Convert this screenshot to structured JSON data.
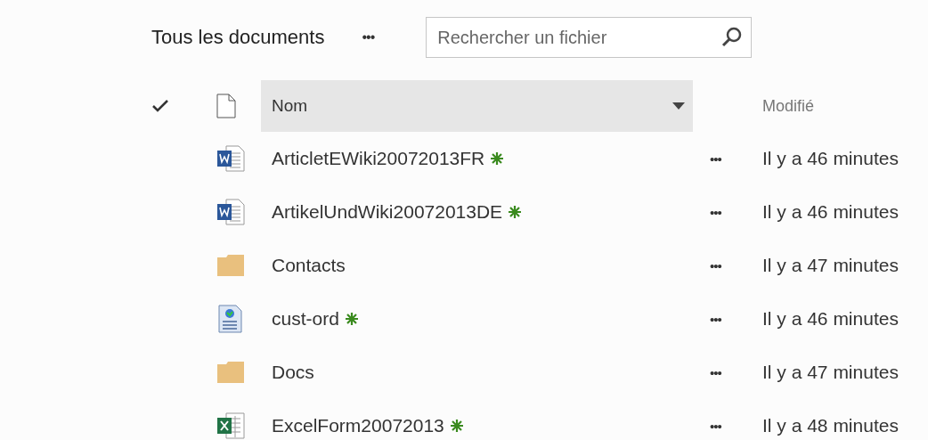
{
  "view": {
    "title": "Tous les documents",
    "more": "•••",
    "search": {
      "placeholder": "Rechercher un fichier"
    }
  },
  "columns": {
    "name": "Nom",
    "modified": "Modifié"
  },
  "rows": [
    {
      "kind": "word",
      "name": "ArticletEWiki20072013FR",
      "new": true,
      "more": "•••",
      "modified": "Il y a 46 minutes"
    },
    {
      "kind": "word",
      "name": "ArtikelUndWiki20072013DE",
      "new": true,
      "more": "•••",
      "modified": "Il y a 46 minutes"
    },
    {
      "kind": "folder",
      "name": "Contacts",
      "new": false,
      "more": "•••",
      "modified": "Il y a 47 minutes"
    },
    {
      "kind": "web",
      "name": "cust-ord",
      "new": true,
      "more": "•••",
      "modified": "Il y a 46 minutes"
    },
    {
      "kind": "folder",
      "name": "Docs",
      "new": false,
      "more": "•••",
      "modified": "Il y a 47 minutes"
    },
    {
      "kind": "excel",
      "name": "ExcelForm20072013",
      "new": true,
      "more": "•••",
      "modified": "Il y a 48 minutes"
    }
  ]
}
